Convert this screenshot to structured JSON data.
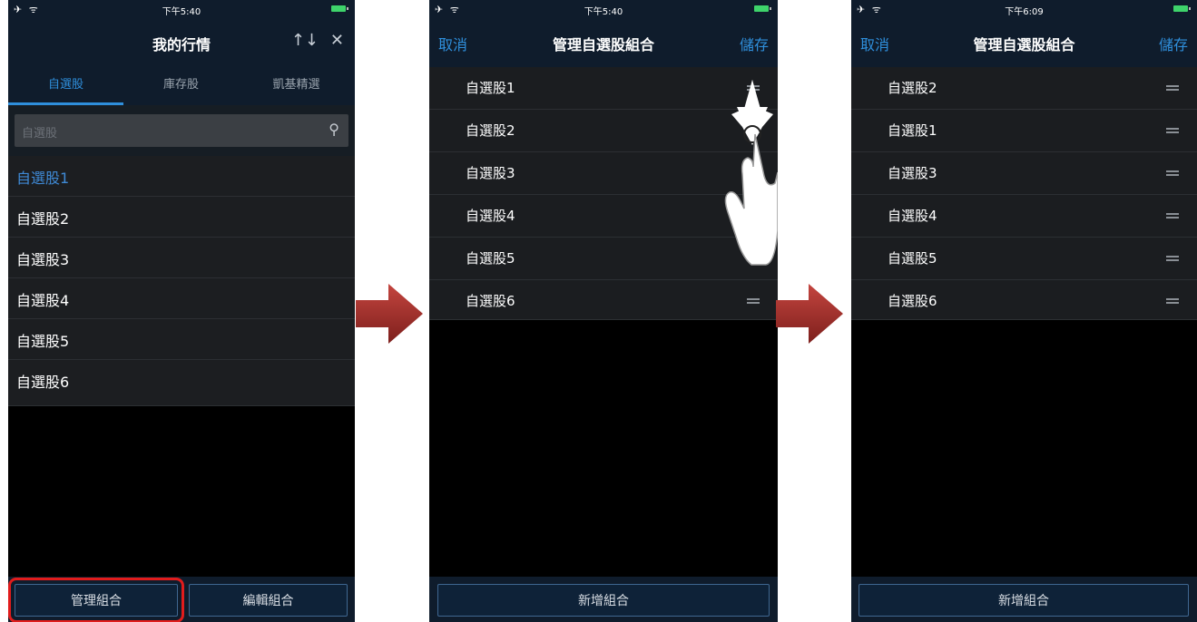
{
  "colors": {
    "accent": "#2f8fdc",
    "highlight_box": "#e11c1c",
    "arrow": "#a8312d"
  },
  "screen1": {
    "status": {
      "signal": "✈ ᯤ",
      "time": "下午5:40"
    },
    "title": "我的行情",
    "sort_icon": "↑↓",
    "close_icon": "✕",
    "tabs": [
      {
        "label": "自選股"
      },
      {
        "label": "庫存股"
      },
      {
        "label": "凱基精選"
      }
    ],
    "search": {
      "placeholder": "自選股",
      "icon": "search-icon"
    },
    "list": [
      {
        "label": "自選股1"
      },
      {
        "label": "自選股2"
      },
      {
        "label": "自選股3"
      },
      {
        "label": "自選股4"
      },
      {
        "label": "自選股5"
      },
      {
        "label": "自選股6"
      }
    ],
    "buttons": {
      "manage": "管理組合",
      "edit": "編輯組合"
    }
  },
  "screen2": {
    "status": {
      "signal": "✈ ᯤ",
      "time": "下午5:40"
    },
    "title": "管理自選股組合",
    "cancel": "取消",
    "save": "儲存",
    "list": [
      {
        "label": "自選股1"
      },
      {
        "label": "自選股2"
      },
      {
        "label": "自選股3"
      },
      {
        "label": "自選股4"
      },
      {
        "label": "自選股5"
      },
      {
        "label": "自選股6"
      }
    ],
    "add": "新增組合"
  },
  "screen3": {
    "status": {
      "signal": "✈ ᯤ",
      "time": "下午6:09"
    },
    "title": "管理自選股組合",
    "cancel": "取消",
    "save": "儲存",
    "list": [
      {
        "label": "自選股2"
      },
      {
        "label": "自選股1"
      },
      {
        "label": "自選股3"
      },
      {
        "label": "自選股4"
      },
      {
        "label": "自選股5"
      },
      {
        "label": "自選股6"
      }
    ],
    "add": "新增組合"
  }
}
